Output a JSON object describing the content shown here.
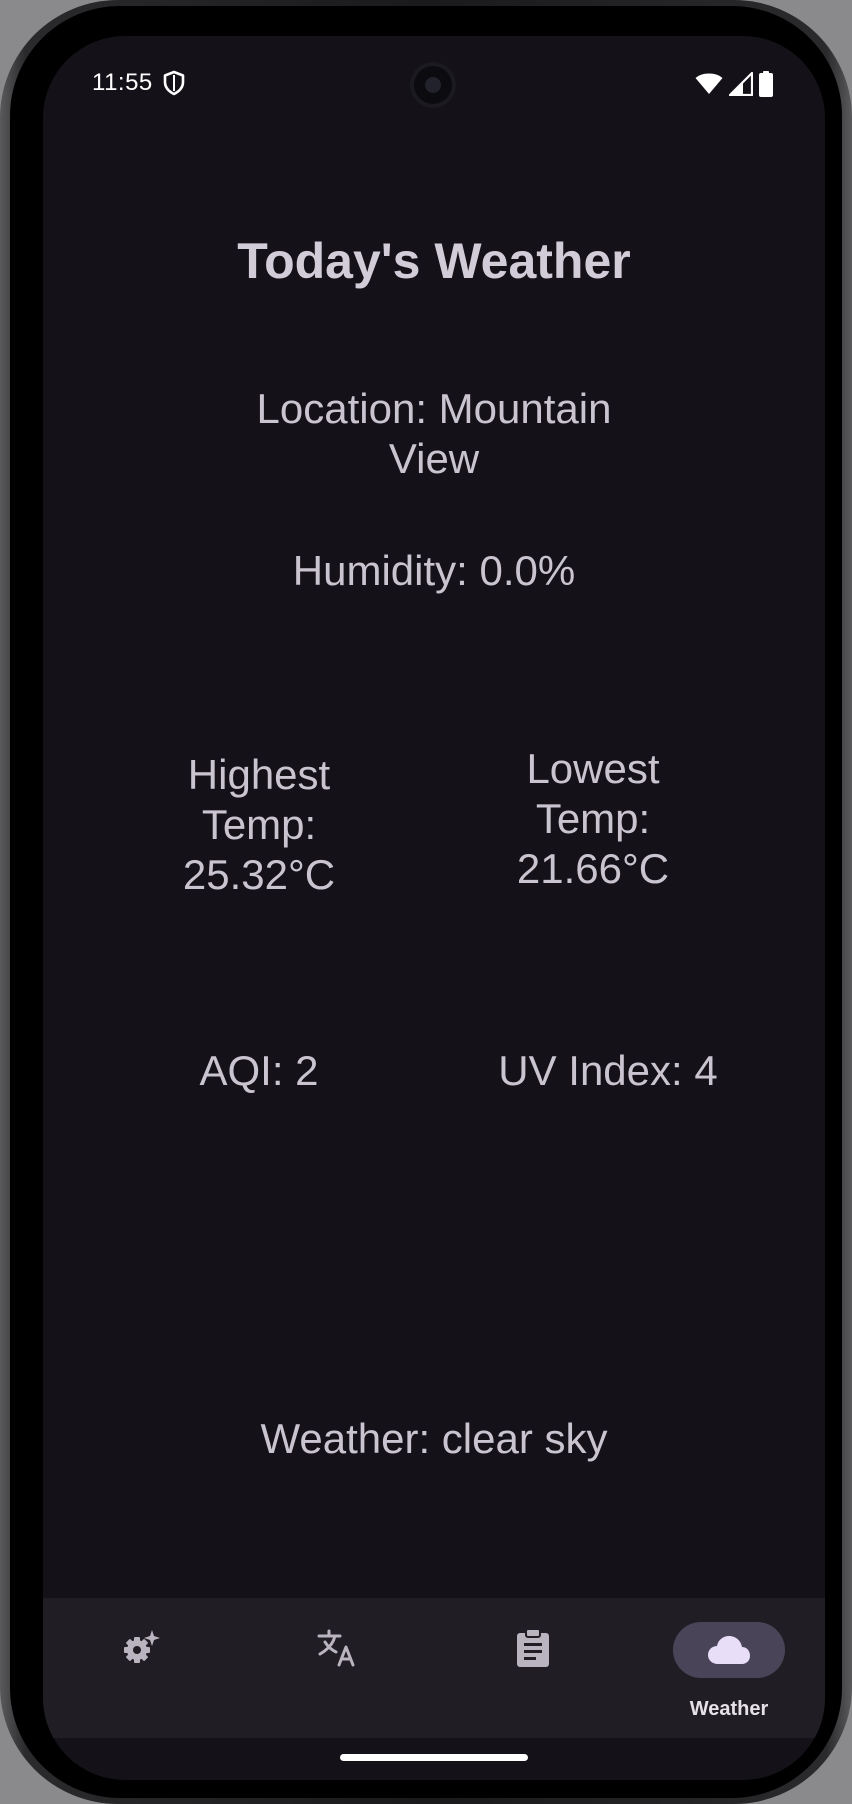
{
  "status_bar": {
    "time": "11:55",
    "icons": [
      "shield-icon",
      "wifi-icon",
      "signal-icon",
      "battery-icon"
    ]
  },
  "weather": {
    "title": "Today's Weather",
    "location": "Location: Mountain View",
    "humidity": "Humidity: 0.0%",
    "highest_temp": "Highest Temp: 25.32°C",
    "lowest_temp": "Lowest Temp: 21.66°C",
    "aqi": "AQI: 2",
    "uv_index": "UV Index: 4",
    "condition": "Weather: clear sky"
  },
  "bottom_nav": {
    "items": [
      {
        "icon": "settings-sparkle-icon",
        "label": "",
        "selected": false
      },
      {
        "icon": "translate-icon",
        "label": "",
        "selected": false
      },
      {
        "icon": "clipboard-icon",
        "label": "",
        "selected": false
      },
      {
        "icon": "cloud-icon",
        "label": "Weather",
        "selected": true
      }
    ]
  },
  "colors": {
    "background": "#141218",
    "nav_background": "#201e24",
    "text": "#cac4d0",
    "selected_pill": "#4a4458",
    "selected_icon": "#e8def8"
  }
}
